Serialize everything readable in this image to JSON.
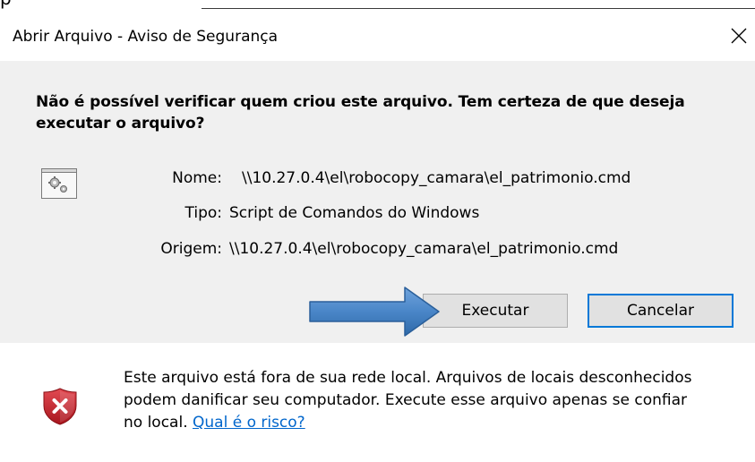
{
  "window": {
    "title": "Abrir Arquivo - Aviso de Segurança",
    "close_glyph": "✕"
  },
  "dialog": {
    "question": "Não é possível verificar quem criou este arquivo. Tem certeza de que deseja executar o arquivo?",
    "file_icon": "gear-file-icon",
    "fields": {
      "name_label": "Nome:",
      "name_value": "\\\\10.27.0.4\\el\\robocopy_camara\\el_patrimonio.cmd",
      "type_label": "Tipo:",
      "type_value": "Script de Comandos do Windows",
      "origin_label": "Origem:",
      "origin_value": "\\\\10.27.0.4\\el\\robocopy_camara\\el_patrimonio.cmd"
    },
    "buttons": {
      "execute_label": "Executar",
      "cancel_label": "Cancelar"
    },
    "annotation_arrow": "blue-arrow-pointing-right"
  },
  "warning": {
    "icon": "shield-error-icon",
    "line1": "Este arquivo está fora de sua rede local. Arquivos de locais desconhecidos",
    "line2": "podem danificar seu computador. Execute esse arquivo apenas se confiar",
    "line3_prefix": "no local. ",
    "risk_link": "Qual é o risco?"
  },
  "colors": {
    "accent": "#0078d7",
    "content_bg": "#f0f0f0",
    "button_bg": "#e1e1e1",
    "link": "#0066cc",
    "arrow": "#4a86c8",
    "shield": "#c4262e"
  }
}
